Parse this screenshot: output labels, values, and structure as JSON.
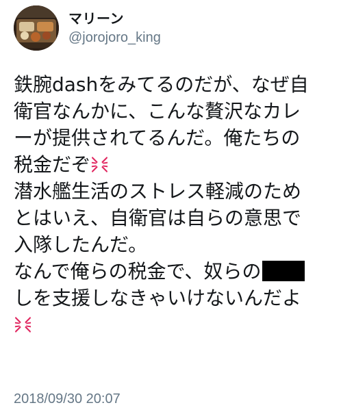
{
  "user": {
    "display_name": "マリーン",
    "handle": "@jorojoro_king",
    "avatar_icon": "avatar-photo-icon"
  },
  "tweet": {
    "lines": [
      {
        "text": "鉄腕dashをみてるのだが、なぜ自"
      },
      {
        "text": "衛官なんかに、こんな贅沢なカレ"
      },
      {
        "text": "ーが提供されてるんだ。俺たちの"
      },
      {
        "text": "税金だぞ",
        "trailing_icon": "anger-symbol-icon"
      },
      {
        "text": "潜水艦生活のストレス軽減のため"
      },
      {
        "text": "とはいえ、自衛官は自らの意思で"
      },
      {
        "text": "入隊したんだ。"
      },
      {
        "text": "なんで俺らの税金で、奴らの",
        "trailing_redaction": true
      },
      {
        "text": "しを支援しなきゃいけないんだよ"
      },
      {
        "text": "",
        "trailing_icon": "anger-symbol-icon"
      }
    ],
    "timestamp": "2018/09/30 20:07"
  },
  "colors": {
    "text": "#14171a",
    "secondary": "#657786",
    "anger": "#e0245e",
    "redaction": "#000000",
    "background": "#ffffff"
  }
}
